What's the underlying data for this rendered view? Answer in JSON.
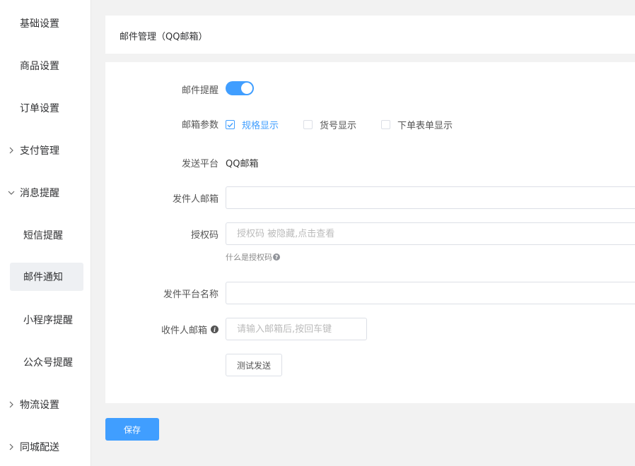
{
  "sidebar": {
    "items": [
      {
        "label": "基础设置"
      },
      {
        "label": "商品设置"
      },
      {
        "label": "订单设置"
      },
      {
        "label": "支付管理",
        "icon": "chevron-right-icon"
      },
      {
        "label": "消息提醒",
        "icon": "chevron-down-icon"
      },
      {
        "label": "短信提醒"
      },
      {
        "label": "邮件通知",
        "active": true
      },
      {
        "label": "小程序提醒"
      },
      {
        "label": "公众号提醒"
      },
      {
        "label": "物流设置",
        "icon": "chevron-right-icon"
      },
      {
        "label": "同城配送",
        "icon": "chevron-right-icon"
      }
    ]
  },
  "header": {
    "title": "邮件管理（QQ邮箱）"
  },
  "form": {
    "email_reminder": {
      "label": "邮件提醒",
      "enabled": true
    },
    "email_params": {
      "label": "邮箱参数",
      "options": [
        {
          "label": "规格显示",
          "checked": true
        },
        {
          "label": "货号显示",
          "checked": false
        },
        {
          "label": "下单表单显示",
          "checked": false
        }
      ]
    },
    "platform": {
      "label": "发送平台",
      "value": "QQ邮箱"
    },
    "sender_email": {
      "label": "发件人邮箱",
      "value": "",
      "placeholder": ""
    },
    "auth_code": {
      "label": "授权码",
      "value": "",
      "placeholder": "授权码 被隐藏,点击查看",
      "hint": "什么是授权码"
    },
    "platform_name": {
      "label": "发件平台名称",
      "value": "",
      "placeholder": ""
    },
    "recipient_email": {
      "label": "收件人邮箱",
      "value": "",
      "placeholder": "请输入邮箱后,按回车键"
    },
    "test_button": "测试发送"
  },
  "save_button": "保存",
  "colors": {
    "accent": "#409eff",
    "page_bg": "#f2f2f2"
  }
}
